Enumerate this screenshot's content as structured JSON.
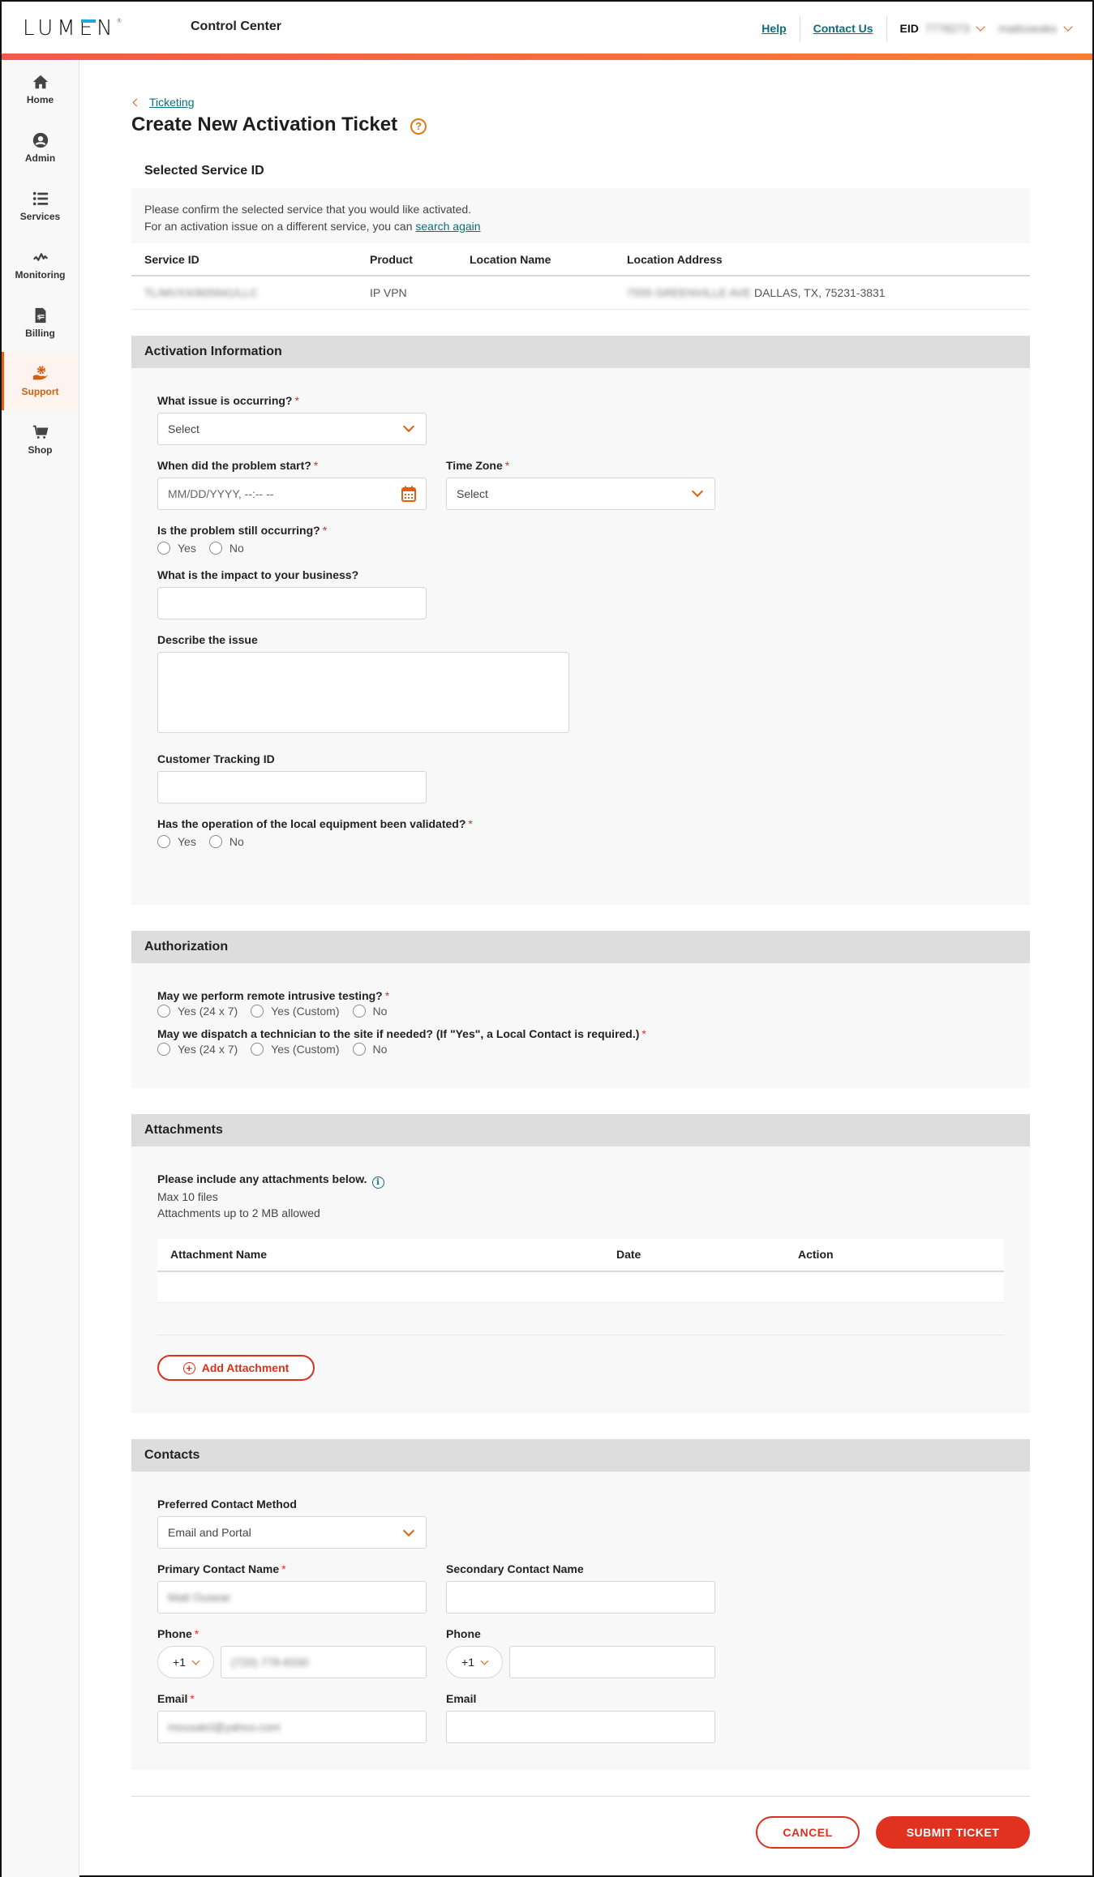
{
  "header": {
    "logo": "LUMEN",
    "app_title": "Control Center",
    "links": {
      "help": "Help",
      "contact_us": "Contact Us"
    },
    "eid_label": "EID",
    "eid_value": "7778273",
    "user_menu": "mattoseaks"
  },
  "colors": {
    "accent": "#e0600f",
    "brand_gradient_start": "#f5574d",
    "brand_gradient_end": "#fb7d33",
    "primary_button": "#e0321e",
    "link": "#0a6f7c"
  },
  "sidebar": {
    "items": [
      {
        "label": "Home",
        "icon": "home-icon",
        "active": false
      },
      {
        "label": "Admin",
        "icon": "user-circle-icon",
        "active": false
      },
      {
        "label": "Services",
        "icon": "list-icon",
        "active": false
      },
      {
        "label": "Monitoring",
        "icon": "pulse-icon",
        "active": false
      },
      {
        "label": "Billing",
        "icon": "invoice-icon",
        "active": false
      },
      {
        "label": "Support",
        "icon": "support-hand-gear-icon",
        "active": true
      },
      {
        "label": "Shop",
        "icon": "cart-icon",
        "active": false
      }
    ]
  },
  "breadcrumb": {
    "back_label": "Ticketing"
  },
  "page": {
    "title": "Create New Activation Ticket",
    "help_icon": "?"
  },
  "selected_service": {
    "heading": "Selected Service ID",
    "line1": "Please confirm the selected service that you would like activated.",
    "line2_prefix": "For an activation issue on a different service, you can ",
    "line2_link": "search again",
    "columns": [
      "Service ID",
      "Product",
      "Location Name",
      "Location Address"
    ],
    "row": {
      "service_id": "TL/MVXX/805941/LLC",
      "product": "IP VPN",
      "location_name": "",
      "address_hidden": "7555 GREENVILLE AVE",
      "address_visible": "DALLAS, TX, 75231-3831"
    }
  },
  "activation": {
    "heading": "Activation Information",
    "issue_label": "What issue is occurring?",
    "issue_value": "Select",
    "start_label": "When did the problem start?",
    "start_placeholder": "MM/DD/YYYY, --:-- --",
    "timezone_label": "Time Zone",
    "timezone_value": "Select",
    "still_label": "Is the problem still occurring?",
    "yes": "Yes",
    "no": "No",
    "impact_label": "What is the impact to your business?",
    "impact_value": "",
    "describe_label": "Describe the issue",
    "describe_value": "",
    "tracking_label": "Customer Tracking ID",
    "tracking_value": "",
    "validated_label": "Has the operation of the local equipment been validated?"
  },
  "authorization": {
    "heading": "Authorization",
    "testing_label": "May we perform remote intrusive testing?",
    "dispatch_label": "May we dispatch a technician to the site if needed? (If \"Yes\", a Local Contact is required.)",
    "options": [
      "Yes (24 x 7)",
      "Yes (Custom)",
      "No"
    ]
  },
  "attachments": {
    "heading": "Attachments",
    "intro": "Please include any attachments below.",
    "max_files": "Max 10 files",
    "max_size": "Attachments up to 2 MB allowed",
    "columns": [
      "Attachment Name",
      "Date",
      "Action"
    ],
    "add_button": "Add Attachment"
  },
  "contacts": {
    "heading": "Contacts",
    "method_label": "Preferred Contact Method",
    "method_value": "Email and Portal",
    "primary_name_label": "Primary Contact Name",
    "primary_name_value": "Matt Ousear",
    "secondary_name_label": "Secondary Contact Name",
    "secondary_name_value": "",
    "phone_label": "Phone",
    "country_code": "+1",
    "primary_phone_value": "(720) 778-8330",
    "secondary_phone_value": "",
    "email_label": "Email",
    "primary_email_value": "mousatcl@yahoo.com",
    "secondary_email_value": ""
  },
  "footer": {
    "cancel": "CANCEL",
    "submit": "SUBMIT TICKET"
  }
}
